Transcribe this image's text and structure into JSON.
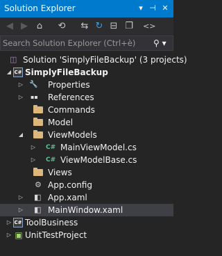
{
  "title": "Solution Explorer",
  "title_buttons": {
    "dropdown": "▾",
    "pin": "⊣",
    "close": "✕"
  },
  "toolbar": {
    "back": "◀",
    "forward": "▶",
    "home": "⌂",
    "history": "⟲",
    "sync": "⇆",
    "refresh": "↻",
    "collapse": "⊟",
    "copy": "❐",
    "code": "<>"
  },
  "search": {
    "placeholder": "Search Solution Explorer (Ctrl+è)",
    "icon": "⚲ ▾"
  },
  "tree": {
    "solution": "Solution 'SimplyFileBackup' (3 projects)",
    "project_main": "SimplyFileBackup",
    "properties": "Properties",
    "references": "References",
    "commands": "Commands",
    "model": "Model",
    "viewmodels": "ViewModels",
    "mainviewmodel": "MainViewModel.cs",
    "viewmodelbase": "ViewModelBase.cs",
    "views": "Views",
    "appconfig": "App.config",
    "appxaml": "App.xaml",
    "mainwindow": "MainWindow.xaml",
    "toolbusiness": "ToolBusiness",
    "unittest": "UnitTestProject"
  },
  "icons": {
    "cs_project": "C#",
    "cs_file": "C#",
    "wrench": "🔧",
    "refs": "▪▪",
    "xaml": "◧",
    "config": "⚙",
    "solution": "◫"
  },
  "colors": {
    "accent": "#007acc",
    "background": "#252526",
    "selection": "#3f3f46",
    "folder": "#dcb67a",
    "cs_green": "#4ec98a"
  }
}
